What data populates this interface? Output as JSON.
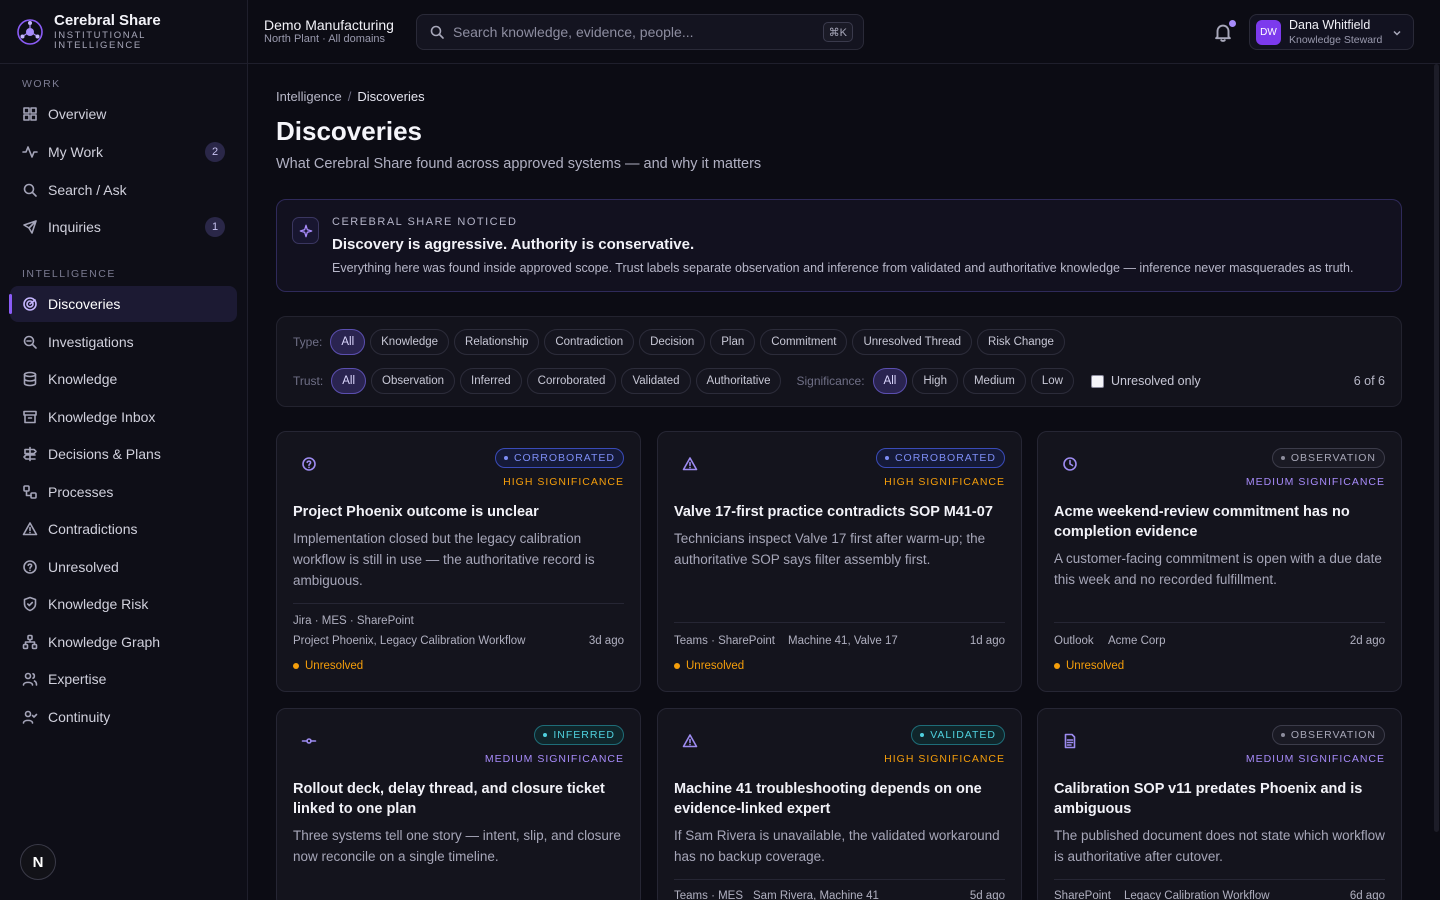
{
  "brand": {
    "name": "Cerebral Share",
    "tagline_1": "INSTITUTIONAL",
    "tagline_2": "INTELLIGENCE"
  },
  "org": {
    "name": "Demo Manufacturing",
    "scope": "North Plant · All domains"
  },
  "search": {
    "placeholder": "Search knowledge, evidence, people...",
    "shortcut": "⌘K"
  },
  "user": {
    "initials": "DW",
    "name": "Dana Whitfield",
    "role": "Knowledge Steward"
  },
  "nav": {
    "work_label": "WORK",
    "work_items": [
      {
        "label": "Overview",
        "icon": "grid-icon"
      },
      {
        "label": "My Work",
        "icon": "activity-icon",
        "badge": "2"
      },
      {
        "label": "Search / Ask",
        "icon": "search-icon"
      },
      {
        "label": "Inquiries",
        "icon": "send-icon",
        "badge": "1"
      }
    ],
    "intel_label": "INTELLIGENCE",
    "intel_items": [
      {
        "label": "Discoveries",
        "icon": "radar-icon",
        "active": true
      },
      {
        "label": "Investigations",
        "icon": "magnify-icon"
      },
      {
        "label": "Knowledge",
        "icon": "database-icon"
      },
      {
        "label": "Knowledge Inbox",
        "icon": "archive-icon"
      },
      {
        "label": "Decisions & Plans",
        "icon": "signpost-icon"
      },
      {
        "label": "Processes",
        "icon": "workflow-icon"
      },
      {
        "label": "Contradictions",
        "icon": "warning-icon"
      },
      {
        "label": "Unresolved",
        "icon": "help-circle-icon"
      },
      {
        "label": "Knowledge Risk",
        "icon": "shield-icon"
      },
      {
        "label": "Knowledge Graph",
        "icon": "graph-icon"
      },
      {
        "label": "Expertise",
        "icon": "users-icon"
      },
      {
        "label": "Continuity",
        "icon": "user-check-icon"
      }
    ],
    "footer_avatar": "N"
  },
  "page": {
    "breadcrumb_root": "Intelligence",
    "breadcrumb_sep": "/",
    "breadcrumb_current": "Discoveries",
    "title": "Discoveries",
    "subtitle": "What Cerebral Share found across approved systems — and why it matters"
  },
  "notice": {
    "kicker": "CEREBRAL SHARE NOTICED",
    "headline": "Discovery is aggressive. Authority is conservative.",
    "body": "Everything here was found inside approved scope. Trust labels separate observation and inference from validated and authoritative knowledge — inference never masquerades as truth."
  },
  "filters": {
    "type_label": "Type:",
    "type_options": [
      "All",
      "Knowledge",
      "Relationship",
      "Contradiction",
      "Decision",
      "Plan",
      "Commitment",
      "Unresolved Thread",
      "Risk Change"
    ],
    "trust_label": "Trust:",
    "trust_options": [
      "All",
      "Observation",
      "Inferred",
      "Corroborated",
      "Validated",
      "Authoritative"
    ],
    "significance_label": "Significance:",
    "significance_options": [
      "All",
      "High",
      "Medium",
      "Low"
    ],
    "unresolved_only_label": "Unresolved only",
    "result_count": "6 of 6"
  },
  "cards": [
    {
      "icon": "help-circle-icon",
      "trust": "CORROBORATED",
      "trust_kind": "corroborated",
      "significance": "HIGH SIGNIFICANCE",
      "sig_kind": "high",
      "title": "Project Phoenix outcome is unclear",
      "desc": "Implementation closed but the legacy calibration workflow is still in use — the authoritative record is ambiguous.",
      "sources": "Jira · MES · SharePoint",
      "entities": "Project Phoenix, Legacy Calibration Workflow",
      "age": "3d ago",
      "status": "Unresolved"
    },
    {
      "icon": "warning-icon",
      "trust": "CORROBORATED",
      "trust_kind": "corroborated",
      "significance": "HIGH SIGNIFICANCE",
      "sig_kind": "high",
      "title": "Valve 17-first practice contradicts SOP M41-07",
      "desc": "Technicians inspect Valve 17 first after warm-up; the authoritative SOP says filter assembly first.",
      "sources": "Teams · SharePoint",
      "entities": "Machine 41, Valve 17",
      "age": "1d ago",
      "status": "Unresolved"
    },
    {
      "icon": "clock-icon",
      "trust": "OBSERVATION",
      "trust_kind": "observation",
      "significance": "MEDIUM SIGNIFICANCE",
      "sig_kind": "medium",
      "title": "Acme weekend-review commitment has no completion evidence",
      "desc": "A customer-facing commitment is open with a due date this week and no recorded fulfillment.",
      "sources": "Outlook",
      "entities": "Acme Corp",
      "age": "2d ago",
      "status": "Unresolved"
    },
    {
      "icon": "commit-icon",
      "trust": "INFERRED",
      "trust_kind": "inferred",
      "significance": "MEDIUM SIGNIFICANCE",
      "sig_kind": "medium",
      "title": "Rollout deck, delay thread, and closure ticket linked to one plan",
      "desc": "Three systems tell one story — intent, slip, and closure now reconcile on a single timeline."
    },
    {
      "icon": "warning-icon",
      "trust": "VALIDATED",
      "trust_kind": "validated",
      "significance": "HIGH SIGNIFICANCE",
      "sig_kind": "high",
      "title": "Machine 41 troubleshooting depends on one evidence-linked expert",
      "desc": "If Sam Rivera is unavailable, the validated workaround has no backup coverage.",
      "sources": "Teams · MES",
      "entities": "Sam Rivera, Machine 41",
      "age": "5d ago"
    },
    {
      "icon": "document-icon",
      "trust": "OBSERVATION",
      "trust_kind": "observation",
      "significance": "MEDIUM SIGNIFICANCE",
      "sig_kind": "medium",
      "title": "Calibration SOP v11 predates Phoenix and is ambiguous",
      "desc": "The published document does not state which workflow is authoritative after cutover.",
      "sources": "SharePoint",
      "entities": "Legacy Calibration Workflow",
      "age": "6d ago"
    }
  ]
}
